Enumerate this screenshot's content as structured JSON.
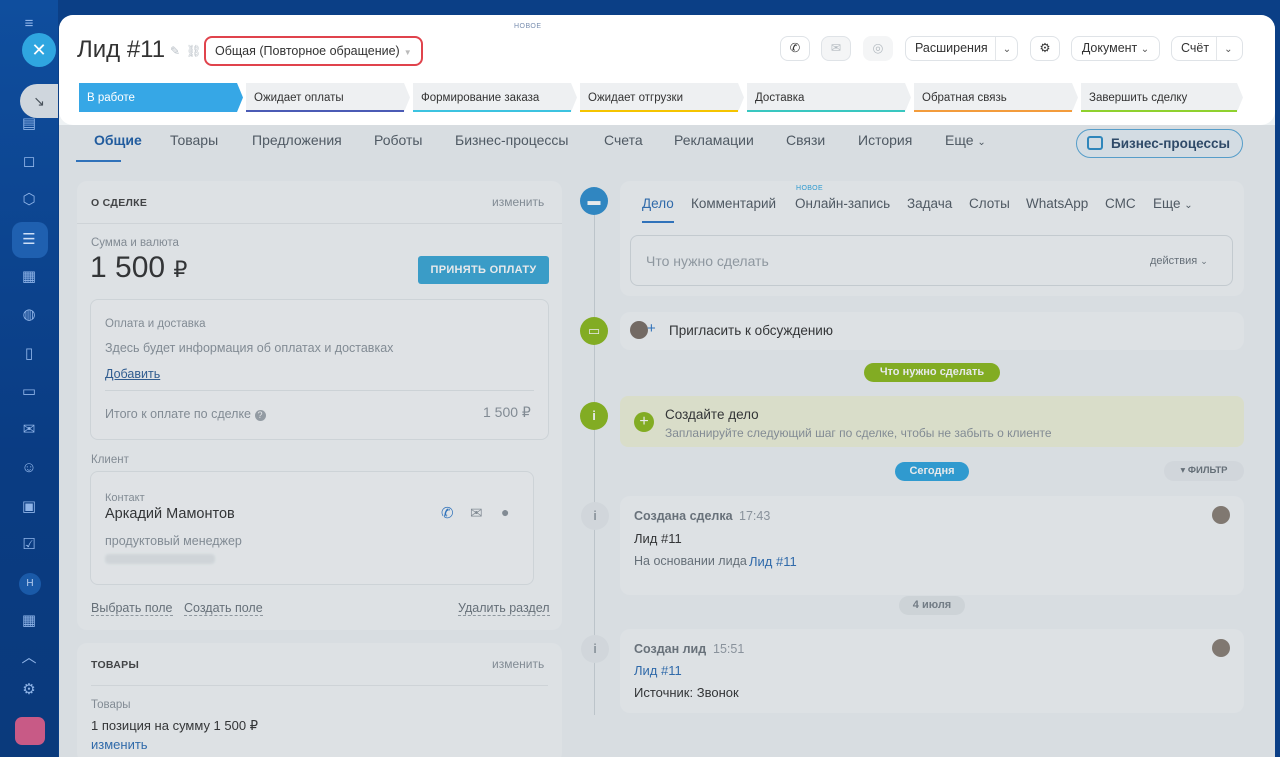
{
  "rail": {
    "icons": [
      "menu-icon",
      "close-icon",
      "pin-icon",
      "feed-icon",
      "chat-icon",
      "hex-icon",
      "funnel-icon",
      "calendar-icon",
      "robot-icon",
      "document-icon",
      "card-icon",
      "mail-icon",
      "contacts-icon",
      "presentation-icon",
      "tasks-icon",
      "user-initial",
      "calendar2-icon",
      "settings-icon",
      "app-icon"
    ],
    "initial": "Н"
  },
  "header": {
    "new_badge": "НОВОЕ",
    "title": "Лид #11",
    "category": "Общая (Повторное обращение)",
    "buttons": {
      "extensions": "Расширения",
      "document": "Документ",
      "invoice": "Счёт"
    },
    "stages": [
      {
        "label": "В работе",
        "color": "#36a7e6"
      },
      {
        "label": "Ожидает оплаты",
        "color": "#4b5bb5"
      },
      {
        "label": "Формирование заказа",
        "color": "#3cc3e0"
      },
      {
        "label": "Ожидает отгрузки",
        "color": "#f5c400"
      },
      {
        "label": "Доставка",
        "color": "#39c7c0"
      },
      {
        "label": "Обратная связь",
        "color": "#f39c3c"
      },
      {
        "label": "Завершить сделку",
        "color": "#8fd12e"
      }
    ]
  },
  "tabs": [
    "Общие",
    "Товары",
    "Предложения",
    "Роботы",
    "Бизнес-процессы",
    "Счета",
    "Рекламации",
    "Связи",
    "История",
    "Еще"
  ],
  "bp_button": "Бизнес-процессы",
  "about": {
    "title": "О СДЕЛКЕ",
    "edit": "изменить",
    "amount_label": "Сумма и валюта",
    "amount": "1 500",
    "currency": "₽",
    "pay_button": "ПРИНЯТЬ ОПЛАТУ",
    "payment_title": "Оплата и доставка",
    "payment_info": "Здесь будет информация об оплатах и доставках",
    "add_link": "Добавить",
    "total_label": "Итого к оплате по сделке",
    "total_value": "1 500 ₽",
    "client_label": "Клиент",
    "contact_label": "Контакт",
    "contact_name": "Аркадий Мамонтов",
    "contact_position": "продуктовый менеджер",
    "choose_field": "Выбрать поле",
    "create_field": "Создать поле",
    "delete_section": "Удалить раздел"
  },
  "goods": {
    "title": "ТОВАРЫ",
    "edit": "изменить",
    "label": "Товары",
    "summary": "1 позиция на сумму 1 500 ₽",
    "edit_link": "изменить"
  },
  "activity": {
    "tabs": [
      "Дело",
      "Комментарий",
      "Онлайн-запись",
      "Задача",
      "Слоты",
      "WhatsApp",
      "СМС",
      "Еще"
    ],
    "new_badge": "НОВОЕ",
    "placeholder": "Что нужно сделать",
    "actions": "действия",
    "invite": "Пригласить к обсуждению",
    "todo_pill": "Что нужно сделать",
    "create_title": "Создайте дело",
    "create_text": "Запланируйте следующий шаг по сделке, чтобы не забыть о клиенте",
    "today_pill": "Сегодня",
    "filter": "ФИЛЬТР",
    "date_pill": "4 июля",
    "event1": {
      "title": "Создана сделка",
      "time": "17:43",
      "name": "Лид #11",
      "basis": "На основании лида",
      "basis_link": "Лид #11"
    },
    "event2": {
      "title": "Создан лид",
      "time": "15:51",
      "link": "Лид #11",
      "source": "Источник: Звонок"
    }
  }
}
